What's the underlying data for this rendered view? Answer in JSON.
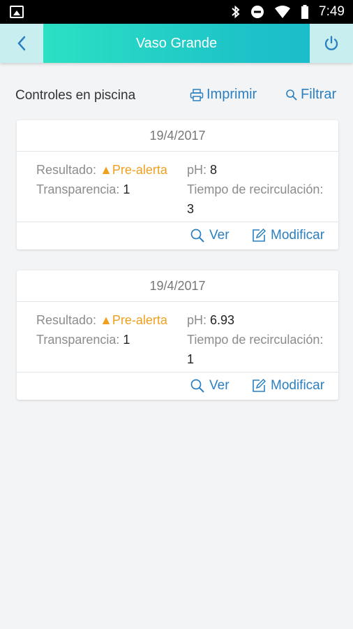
{
  "status": {
    "time": "7:49"
  },
  "header": {
    "title": "Vaso Grande"
  },
  "toolbar": {
    "label": "Controles en piscina",
    "print_label": "Imprimir",
    "filter_label": "Filtrar"
  },
  "controls": [
    {
      "date": "19/4/2017",
      "result_label": "Resultado:",
      "result_value": "Pre-alerta",
      "ph_label": "pH:",
      "ph_value": "8",
      "transparency_label": "Transparencia:",
      "transparency_value": "1",
      "recirculation_label": "Tiempo de recirculación:",
      "recirculation_value": "3",
      "view_label": "Ver",
      "edit_label": "Modificar"
    },
    {
      "date": "19/4/2017",
      "result_label": "Resultado:",
      "result_value": "Pre-alerta",
      "ph_label": "pH:",
      "ph_value": "6.93",
      "transparency_label": "Transparencia:",
      "transparency_value": "1",
      "recirculation_label": "Tiempo de recirculación:",
      "recirculation_value": "1",
      "view_label": "Ver",
      "edit_label": "Modificar"
    }
  ],
  "colors": {
    "accent": "#2a7fc0",
    "warning": "#f0a020",
    "header_start": "#2ee6c3",
    "header_end": "#1bb8cc"
  }
}
